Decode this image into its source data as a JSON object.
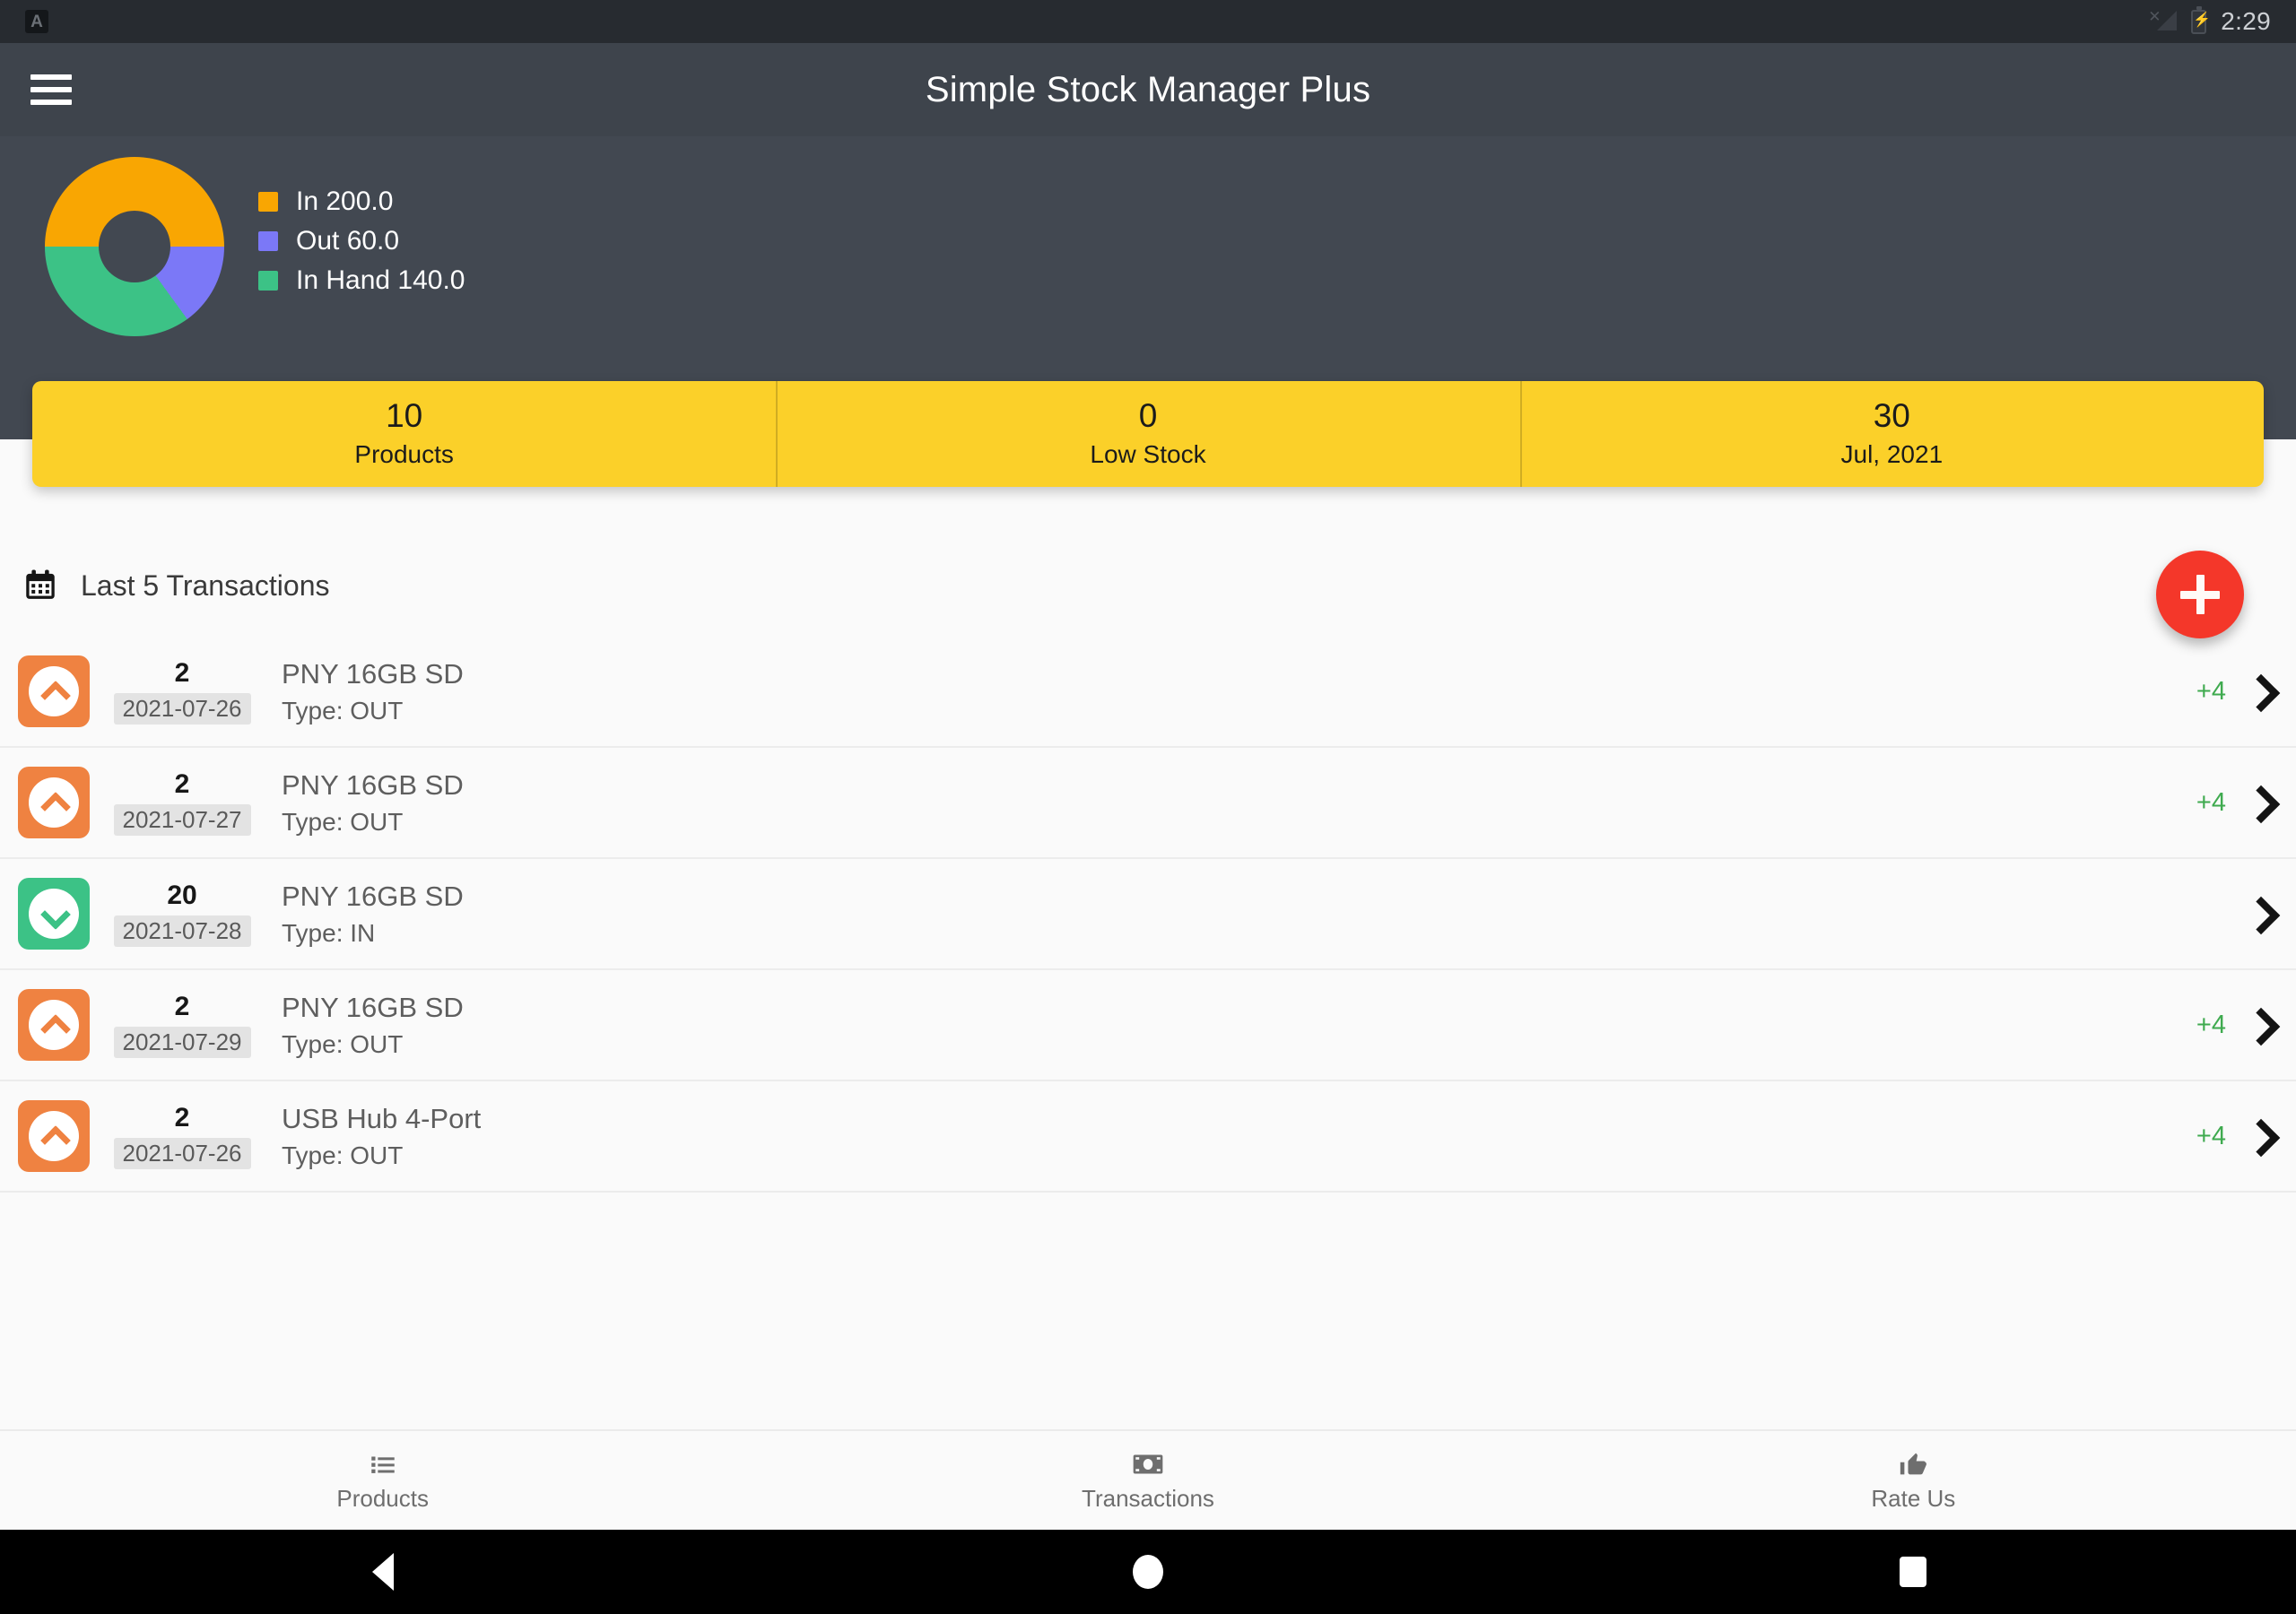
{
  "status_bar": {
    "app_badge": "A",
    "time": "2:29",
    "icons": {
      "signal": "signal-no-service-icon",
      "battery": "battery-charging-icon"
    }
  },
  "app_bar": {
    "menu_icon": "hamburger-menu-icon",
    "title": "Simple Stock Manager Plus"
  },
  "summary": {
    "legend": [
      {
        "label": "In 200.0",
        "color": "#f9a602"
      },
      {
        "label": "Out 60.0",
        "color": "#7b78f7"
      },
      {
        "label": "In Hand 140.0",
        "color": "#3cc286"
      }
    ]
  },
  "chart_data": {
    "type": "pie",
    "title": "",
    "variant": "donut",
    "labels": [
      "In",
      "Out",
      "In Hand"
    ],
    "values": [
      200.0,
      60.0,
      140.0
    ],
    "colors": [
      "#f9a602",
      "#7b78f7",
      "#3cc286"
    ],
    "legend_text": [
      "In 200.0",
      "Out 60.0",
      "In Hand 140.0"
    ],
    "legend_position": "right",
    "total": 400.0,
    "percentages": [
      50.0,
      15.0,
      35.0
    ],
    "start_angle_deg": 180,
    "direction": "clockwise",
    "inner_radius_ratio": 0.4
  },
  "stats": [
    {
      "value": "10",
      "label": "Products"
    },
    {
      "value": "0",
      "label": "Low Stock"
    },
    {
      "value": "30",
      "label": "Jul, 2021"
    }
  ],
  "transactions_header": {
    "icon": "calendar-icon",
    "title": "Last 5 Transactions"
  },
  "fab": {
    "icon": "plus-icon",
    "color": "#f4372a"
  },
  "transactions": [
    {
      "qty": "2",
      "date": "2021-07-26",
      "product": "PNY 16GB SD",
      "type": "Type: OUT",
      "direction": "out",
      "extra": "+4"
    },
    {
      "qty": "2",
      "date": "2021-07-27",
      "product": "PNY 16GB SD",
      "type": "Type: OUT",
      "direction": "out",
      "extra": "+4"
    },
    {
      "qty": "20",
      "date": "2021-07-28",
      "product": "PNY 16GB SD",
      "type": "Type: IN",
      "direction": "in",
      "extra": ""
    },
    {
      "qty": "2",
      "date": "2021-07-29",
      "product": "PNY 16GB SD",
      "type": "Type: OUT",
      "direction": "out",
      "extra": "+4"
    },
    {
      "qty": "2",
      "date": "2021-07-26",
      "product": "USB Hub 4-Port",
      "type": "Type: OUT",
      "direction": "out",
      "extra": "+4"
    }
  ],
  "bottom_nav": [
    {
      "label": "Products",
      "icon": "list-icon"
    },
    {
      "label": "Transactions",
      "icon": "money-icon"
    },
    {
      "label": "Rate Us",
      "icon": "thumbs-up-icon"
    }
  ],
  "android_nav": [
    {
      "name": "back-button"
    },
    {
      "name": "home-button"
    },
    {
      "name": "recents-button"
    }
  ],
  "colors": {
    "app_bar": "#3e444c",
    "summary_panel": "#424851",
    "accent_yellow": "#fbd029",
    "fab_red": "#f4372a",
    "in_green": "#3cc286",
    "out_orange": "#ef8241",
    "extra_green": "#3faa4f"
  }
}
